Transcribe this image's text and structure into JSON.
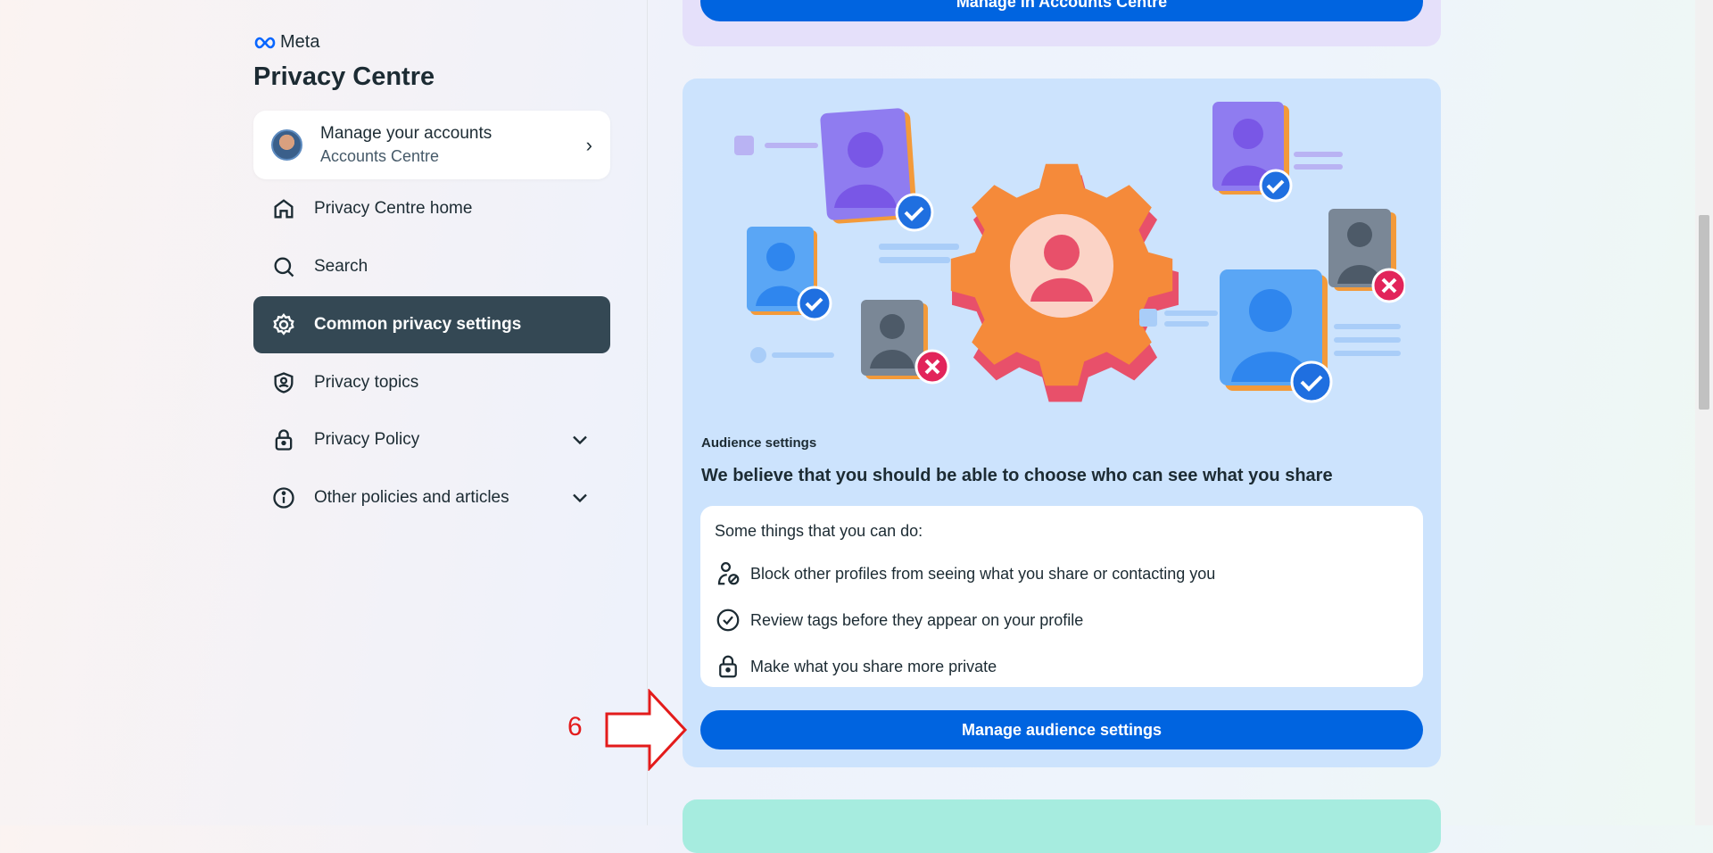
{
  "sidebar": {
    "brand": "Meta",
    "title": "Privacy Centre",
    "account": {
      "title": "Manage your accounts",
      "subtitle": "Accounts Centre"
    },
    "items": [
      {
        "label": "Privacy Centre home",
        "icon": "home-icon"
      },
      {
        "label": "Search",
        "icon": "search-icon"
      },
      {
        "label": "Common privacy settings",
        "icon": "gear-icon",
        "active": true
      },
      {
        "label": "Privacy topics",
        "icon": "shield-icon"
      },
      {
        "label": "Privacy Policy",
        "icon": "lock-icon",
        "expandable": true
      },
      {
        "label": "Other policies and articles",
        "icon": "info-icon",
        "expandable": true
      }
    ]
  },
  "main": {
    "top_card": {
      "button": "Manage in Accounts Centre"
    },
    "audience": {
      "label": "Audience settings",
      "heading": "We believe that you should be able to choose who can see what you share",
      "intro": "Some things that you can do:",
      "items": [
        {
          "text": "Block other profiles from seeing what you share or contacting you",
          "icon": "block-person-icon"
        },
        {
          "text": "Review tags before they appear on your profile",
          "icon": "check-circle-icon"
        },
        {
          "text": "Make what you share more private",
          "icon": "lock-icon"
        }
      ],
      "button": "Manage audience settings"
    }
  },
  "annotation": {
    "step": "6",
    "color": "#e31b1b"
  },
  "colors": {
    "primary": "#0064e0",
    "active_nav": "#344854",
    "card_bg": "#cce3fd"
  }
}
